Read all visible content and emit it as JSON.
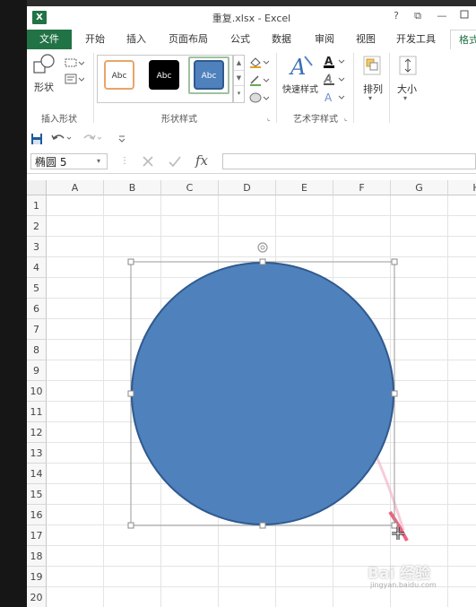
{
  "title_bar": {
    "app_icon": "X",
    "title": "重复.xlsx - Excel",
    "help": "?",
    "ribbon_display": "⧉",
    "minimize": "—"
  },
  "tabs": [
    {
      "label": "文件"
    },
    {
      "label": "开始"
    },
    {
      "label": "插入"
    },
    {
      "label": "页面布局"
    },
    {
      "label": "公式"
    },
    {
      "label": "数据"
    },
    {
      "label": "审阅"
    },
    {
      "label": "视图"
    },
    {
      "label": "开发工具"
    },
    {
      "label": "格式"
    }
  ],
  "ribbon": {
    "shapes_button": "形状",
    "insert_shapes_group": "插入形状",
    "shape_styles_group": "形状样式",
    "style_swatches": [
      {
        "label": "Abc",
        "fill": "#ffffff",
        "border": "#e8a56b",
        "text": "#333333"
      },
      {
        "label": "Abc",
        "fill": "#000000",
        "border": "#000000",
        "text": "#ffffff"
      },
      {
        "label": "Abc",
        "fill": "#4f81bd",
        "border": "#2f5a8e",
        "text": "#ffffff"
      }
    ],
    "quick_styles": "快速样式",
    "wordart_group": "艺术字样式",
    "arrange": "排列",
    "size": "大小"
  },
  "quick_access": {
    "save_icon": "save-icon",
    "undo_icon": "undo-icon",
    "redo_icon": "redo-icon"
  },
  "formula_bar": {
    "name_box": "椭圆 5",
    "fx": "fx",
    "formula_value": ""
  },
  "grid": {
    "columns": [
      "A",
      "B",
      "C",
      "D",
      "E",
      "F",
      "G",
      "H"
    ],
    "rows": [
      "1",
      "2",
      "3",
      "4",
      "5",
      "6",
      "7",
      "8",
      "9",
      "10",
      "11",
      "12",
      "13",
      "14",
      "15",
      "16",
      "17",
      "18",
      "19",
      "20"
    ]
  },
  "shape": {
    "type": "ellipse",
    "fill": "#4f81bd",
    "stroke": "#2f5a8e",
    "selected": true
  },
  "watermark": {
    "text": "Bai 经验",
    "sub": "jingyan.baidu.com"
  }
}
